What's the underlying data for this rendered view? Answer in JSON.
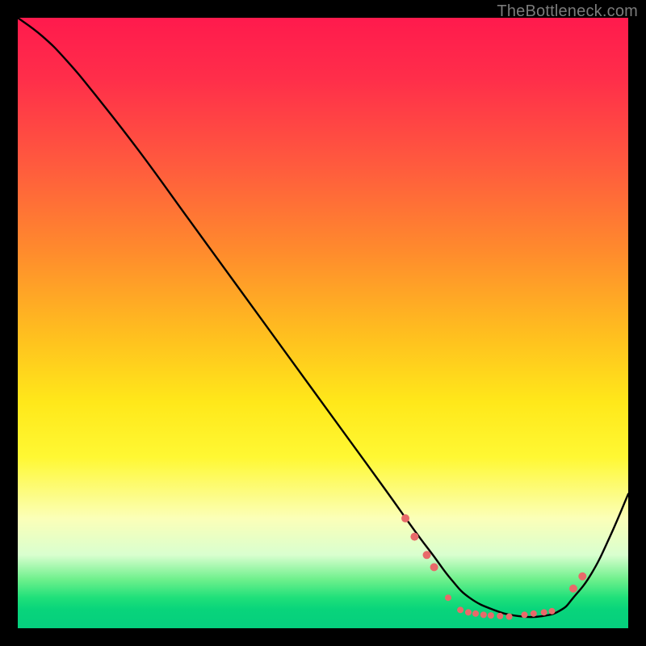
{
  "watermark": "TheBottleneck.com",
  "chart_data": {
    "type": "line",
    "title": "",
    "xlabel": "",
    "ylabel": "",
    "xlim": [
      0,
      100
    ],
    "ylim": [
      0,
      100
    ],
    "grid": false,
    "legend": false,
    "background_gradient": {
      "stops": [
        {
          "pos": 0.0,
          "color": "#ff1a4d"
        },
        {
          "pos": 0.1,
          "color": "#ff2e4a"
        },
        {
          "pos": 0.24,
          "color": "#ff5a3e"
        },
        {
          "pos": 0.38,
          "color": "#ff8a2d"
        },
        {
          "pos": 0.52,
          "color": "#ffbf1f"
        },
        {
          "pos": 0.63,
          "color": "#ffe81a"
        },
        {
          "pos": 0.72,
          "color": "#fff833"
        },
        {
          "pos": 0.82,
          "color": "#fbffb8"
        },
        {
          "pos": 0.88,
          "color": "#d9ffcf"
        },
        {
          "pos": 0.92,
          "color": "#6ef08c"
        },
        {
          "pos": 0.95,
          "color": "#1fe07a"
        },
        {
          "pos": 0.97,
          "color": "#08d47b"
        },
        {
          "pos": 1.0,
          "color": "#05cf7e"
        }
      ]
    },
    "series": [
      {
        "name": "curve",
        "stroke": "#000000",
        "stroke_width": 2.4,
        "x": [
          0,
          4,
          8,
          13,
          20,
          28,
          36,
          44,
          52,
          60,
          65,
          68,
          71,
          74,
          78,
          82,
          86,
          89,
          91,
          94,
          97,
          100
        ],
        "y": [
          100,
          97,
          93,
          87,
          78,
          67,
          56,
          45,
          34,
          23,
          16,
          12,
          8,
          5,
          3,
          2,
          2,
          3,
          5,
          9,
          15,
          22
        ]
      }
    ],
    "markers": [
      {
        "x": 63.5,
        "y": 18.0,
        "r": 5,
        "color": "#e86a6a"
      },
      {
        "x": 65.0,
        "y": 15.0,
        "r": 5,
        "color": "#e86a6a"
      },
      {
        "x": 67.0,
        "y": 12.0,
        "r": 5,
        "color": "#e86a6a"
      },
      {
        "x": 68.2,
        "y": 10.0,
        "r": 5,
        "color": "#e86a6a"
      },
      {
        "x": 70.5,
        "y": 5.0,
        "r": 4,
        "color": "#e86a6a"
      },
      {
        "x": 72.5,
        "y": 3.0,
        "r": 4,
        "color": "#e86a6a"
      },
      {
        "x": 73.8,
        "y": 2.6,
        "r": 4,
        "color": "#e86a6a"
      },
      {
        "x": 75.0,
        "y": 2.4,
        "r": 4,
        "color": "#e86a6a"
      },
      {
        "x": 76.3,
        "y": 2.2,
        "r": 4,
        "color": "#e86a6a"
      },
      {
        "x": 77.5,
        "y": 2.1,
        "r": 4,
        "color": "#e86a6a"
      },
      {
        "x": 79.0,
        "y": 2.0,
        "r": 4,
        "color": "#e86a6a"
      },
      {
        "x": 80.5,
        "y": 1.9,
        "r": 4,
        "color": "#e86a6a"
      },
      {
        "x": 83.0,
        "y": 2.2,
        "r": 4,
        "color": "#e86a6a"
      },
      {
        "x": 84.5,
        "y": 2.4,
        "r": 4,
        "color": "#e86a6a"
      },
      {
        "x": 86.2,
        "y": 2.6,
        "r": 4,
        "color": "#e86a6a"
      },
      {
        "x": 87.5,
        "y": 2.8,
        "r": 4,
        "color": "#e86a6a"
      },
      {
        "x": 91.0,
        "y": 6.5,
        "r": 5,
        "color": "#e86a6a"
      },
      {
        "x": 92.5,
        "y": 8.5,
        "r": 5,
        "color": "#e86a6a"
      }
    ]
  }
}
